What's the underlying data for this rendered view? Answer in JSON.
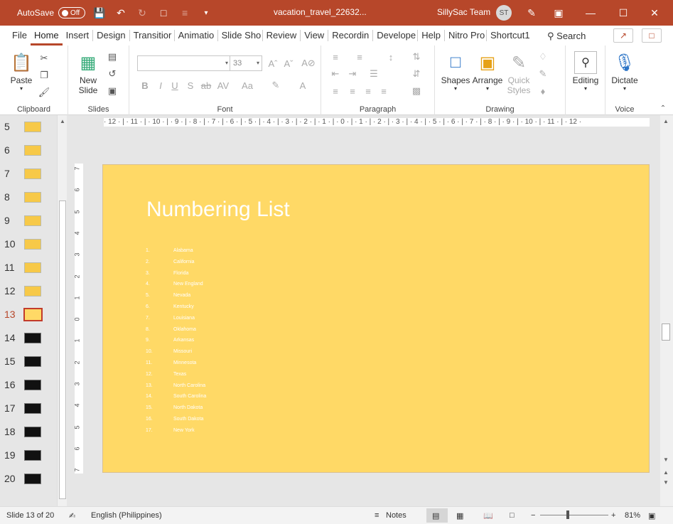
{
  "titlebar": {
    "autosave_label": "AutoSave",
    "autosave_state": "Off",
    "filename": "vacation_travel_22632...",
    "user": "SillySac Team",
    "avatar_initials": "ST"
  },
  "tabs": [
    "File",
    "Home",
    "Insert",
    "Design",
    "Transitior",
    "Animatio",
    "Slide Sho",
    "Review",
    "View",
    "Recordin",
    "Develope",
    "Help",
    "Nitro Pro",
    "Shortcut1"
  ],
  "search_label": "Search",
  "ribbon": {
    "clipboard": {
      "paste": "Paste",
      "label": "Clipboard"
    },
    "slides": {
      "new_slide_1": "New",
      "new_slide_2": "Slide",
      "label": "Slides"
    },
    "font": {
      "size": "33",
      "label": "Font"
    },
    "paragraph": {
      "label": "Paragraph"
    },
    "drawing": {
      "shapes": "Shapes",
      "arrange": "Arrange",
      "quick_1": "Quick",
      "quick_2": "Styles",
      "label": "Drawing"
    },
    "editing": {
      "label": "Editing"
    },
    "voice": {
      "dictate": "Dictate",
      "label": "Voice"
    }
  },
  "thumbnails": [
    {
      "num": "5",
      "style": "yellow"
    },
    {
      "num": "6",
      "style": "yellow"
    },
    {
      "num": "7",
      "style": "yellow"
    },
    {
      "num": "8",
      "style": "yellow"
    },
    {
      "num": "9",
      "style": "yellow"
    },
    {
      "num": "10",
      "style": "yellow"
    },
    {
      "num": "11",
      "style": "yellow"
    },
    {
      "num": "12",
      "style": "yellow"
    },
    {
      "num": "13",
      "style": "current"
    },
    {
      "num": "14",
      "style": "dark"
    },
    {
      "num": "15",
      "style": "dark"
    },
    {
      "num": "16",
      "style": "dark"
    },
    {
      "num": "17",
      "style": "dark"
    },
    {
      "num": "18",
      "style": "dark"
    },
    {
      "num": "19",
      "style": "dark"
    },
    {
      "num": "20",
      "style": "dark"
    }
  ],
  "hruler_text": "· 12 · | · 11 · | · 10 · | · 9 · | · 8 · | · 7 · | · 6 · | · 5 · | · 4 · | · 3 · | · 2 · | · 1 · | · 0 · | · 1 · | · 2 · | · 3 · | · 4 · | · 5 · | · 6 · | · 7 · | · 8 · | · 9 · | · 10 · | · 11 · | · 12 ·",
  "vruler_labels": [
    "7",
    "6",
    "5",
    "4",
    "3",
    "2",
    "1",
    "0",
    "1",
    "2",
    "3",
    "4",
    "5",
    "6",
    "7"
  ],
  "slide": {
    "title": "Numbering List",
    "items": [
      {
        "n": "1.",
        "t": "Alabama"
      },
      {
        "n": "2.",
        "t": "California"
      },
      {
        "n": "3.",
        "t": "Florida"
      },
      {
        "n": "4.",
        "t": "New England"
      },
      {
        "n": "5.",
        "t": "Nevada"
      },
      {
        "n": "6.",
        "t": "Kentucky"
      },
      {
        "n": "7.",
        "t": "Louisiana"
      },
      {
        "n": "8.",
        "t": "Oklahoma"
      },
      {
        "n": "9.",
        "t": "Arkansas"
      },
      {
        "n": "10.",
        "t": "Missouri"
      },
      {
        "n": "11.",
        "t": "Minnesota"
      },
      {
        "n": "12.",
        "t": "Texas"
      },
      {
        "n": "13.",
        "t": "North Carolina"
      },
      {
        "n": "14.",
        "t": "South Carolina"
      },
      {
        "n": "15.",
        "t": "North Dakota"
      },
      {
        "n": "16.",
        "t": "South Dakota"
      },
      {
        "n": "17.",
        "t": "New York"
      }
    ]
  },
  "status": {
    "slide_info": "Slide 13 of 20",
    "language": "English (Philippines)",
    "notes": "Notes",
    "zoom": "81%"
  },
  "colors": {
    "accent": "#b7472a",
    "slide_bg": "#ffd966"
  }
}
